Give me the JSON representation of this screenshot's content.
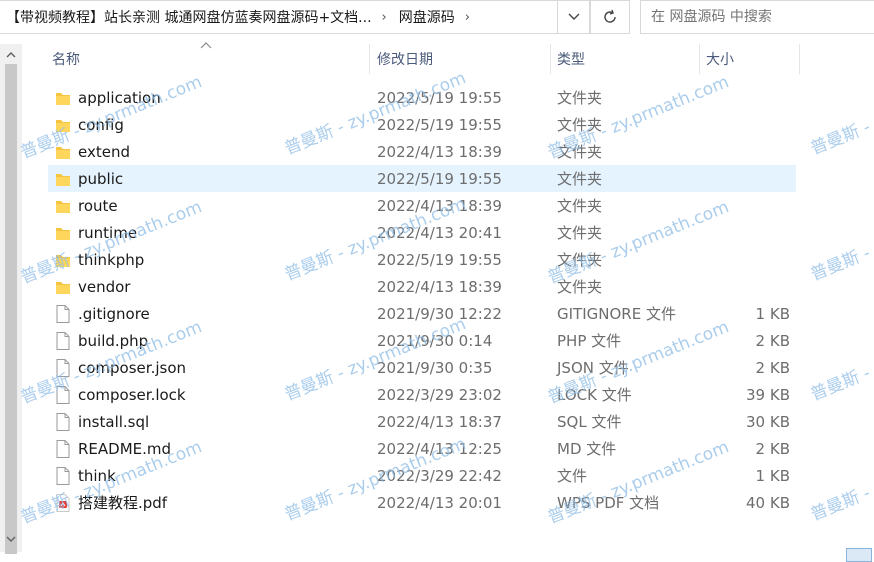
{
  "address_bar": {
    "crumbs": [
      "【带视频教程】站长亲测 城通网盘仿蓝奏网盘源码+文档...",
      "网盘源码"
    ],
    "search_placeholder": "在 网盘源码 中搜索"
  },
  "columns": {
    "name": "名称",
    "date": "修改日期",
    "type": "类型",
    "size": "大小"
  },
  "files": [
    {
      "name": "application",
      "date": "2022/5/19 19:55",
      "type": "文件夹",
      "size": "",
      "icon": "folder-icon"
    },
    {
      "name": "config",
      "date": "2022/5/19 19:55",
      "type": "文件夹",
      "size": "",
      "icon": "folder-icon"
    },
    {
      "name": "extend",
      "date": "2022/4/13 18:39",
      "type": "文件夹",
      "size": "",
      "icon": "folder-icon"
    },
    {
      "name": "public",
      "date": "2022/5/19 19:55",
      "type": "文件夹",
      "size": "",
      "icon": "folder-icon",
      "selected": true
    },
    {
      "name": "route",
      "date": "2022/4/13 18:39",
      "type": "文件夹",
      "size": "",
      "icon": "folder-icon"
    },
    {
      "name": "runtime",
      "date": "2022/4/13 20:41",
      "type": "文件夹",
      "size": "",
      "icon": "folder-icon"
    },
    {
      "name": "thinkphp",
      "date": "2022/5/19 19:55",
      "type": "文件夹",
      "size": "",
      "icon": "folder-icon"
    },
    {
      "name": "vendor",
      "date": "2022/4/13 18:39",
      "type": "文件夹",
      "size": "",
      "icon": "folder-icon"
    },
    {
      "name": ".gitignore",
      "date": "2021/9/30 12:22",
      "type": "GITIGNORE 文件",
      "size": "1 KB",
      "icon": "file-icon"
    },
    {
      "name": "build.php",
      "date": "2021/9/30 0:14",
      "type": "PHP 文件",
      "size": "2 KB",
      "icon": "file-icon"
    },
    {
      "name": "composer.json",
      "date": "2021/9/30 0:35",
      "type": "JSON 文件",
      "size": "2 KB",
      "icon": "file-icon"
    },
    {
      "name": "composer.lock",
      "date": "2022/3/29 23:02",
      "type": "LOCK 文件",
      "size": "39 KB",
      "icon": "file-icon"
    },
    {
      "name": "install.sql",
      "date": "2022/4/13 18:37",
      "type": "SQL 文件",
      "size": "30 KB",
      "icon": "file-icon"
    },
    {
      "name": "README.md",
      "date": "2022/4/13 12:25",
      "type": "MD 文件",
      "size": "2 KB",
      "icon": "file-icon"
    },
    {
      "name": "think",
      "date": "2022/3/29 22:42",
      "type": "文件",
      "size": "1 KB",
      "icon": "file-icon"
    },
    {
      "name": "搭建教程.pdf",
      "date": "2022/4/13 20:01",
      "type": "WPS PDF 文档",
      "size": "40 KB",
      "icon": "pdf-icon"
    }
  ],
  "watermark": "普曼斯 - zy.prmath.com",
  "colors": {
    "selection": "#e5f3ff",
    "folder": "#f5c542",
    "header_text": "#4a5a7a",
    "watermark": "#8fbde6"
  }
}
